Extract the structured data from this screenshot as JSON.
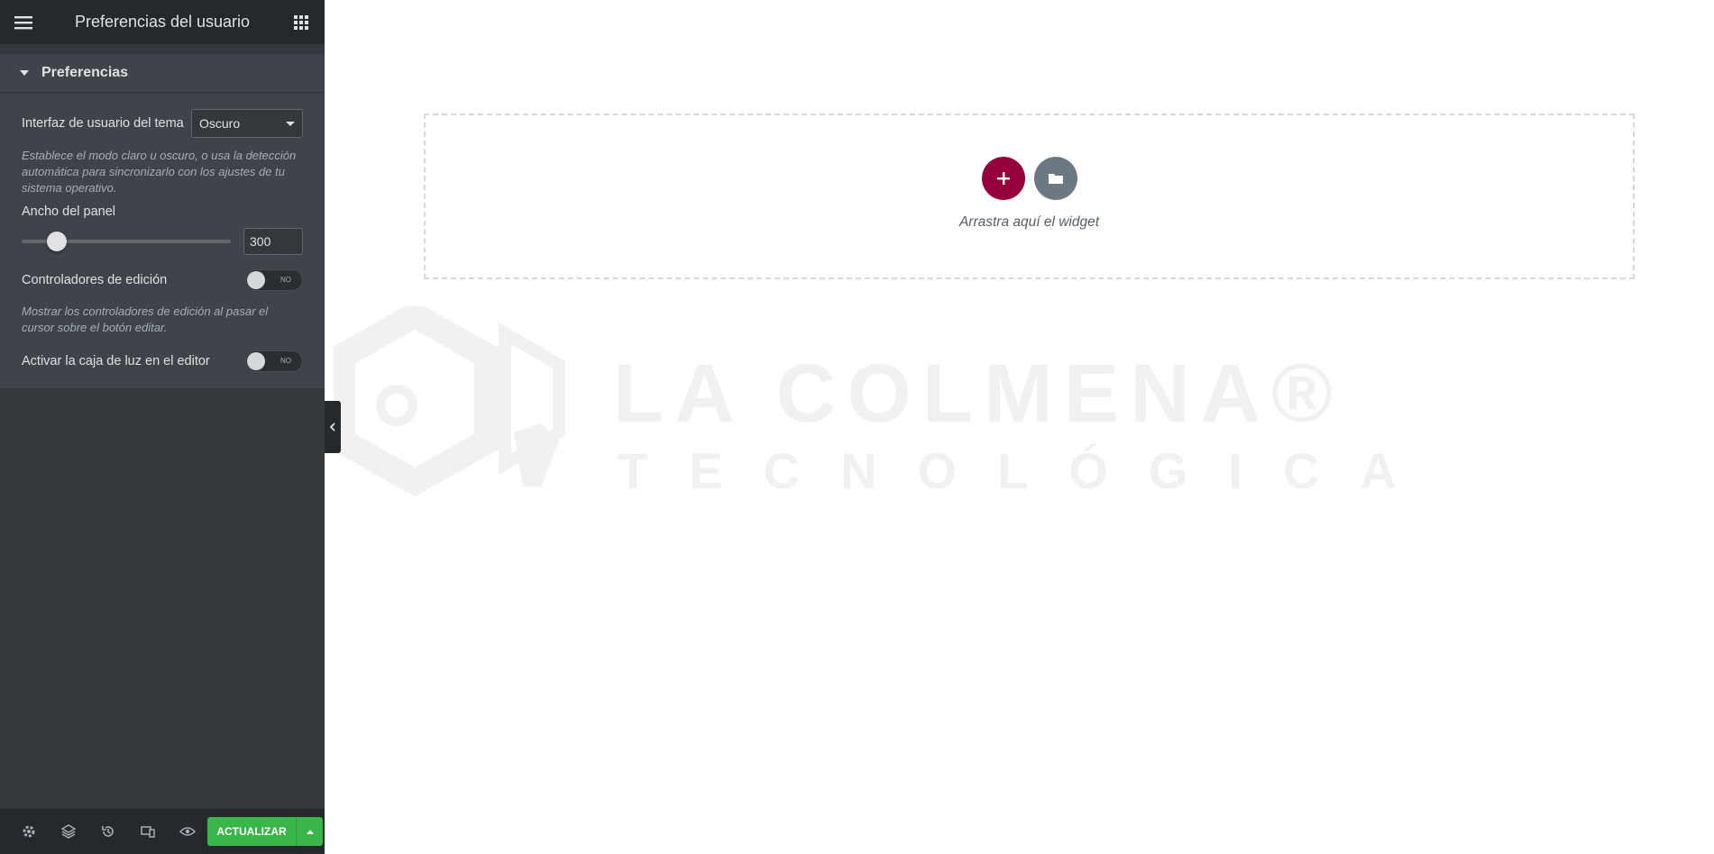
{
  "panel": {
    "title": "Preferencias del usuario",
    "section_title": "Preferencias",
    "theme": {
      "label": "Interfaz de usuario del tema",
      "value": "Oscuro",
      "description": "Establece el modo claro u oscuro, o usa la detección automática para sincronizarlo con los ajustes de tu sistema operativo."
    },
    "panel_width": {
      "label": "Ancho del panel",
      "value": "300",
      "slider_fraction": 0.17
    },
    "edit_handles": {
      "label": "Controladores de edición",
      "toggle_text": "NO",
      "description": "Mostrar los controladores de edición al pasar el cursor sobre el botón editar."
    },
    "lightbox": {
      "label": "Activar la caja de luz en el editor",
      "toggle_text": "NO"
    }
  },
  "footer": {
    "icons": [
      "settings-icon",
      "layers-icon",
      "history-icon",
      "responsive-icon",
      "preview-icon"
    ],
    "update_label": "ACTUALIZAR"
  },
  "canvas": {
    "drop_text": "Arrastra aquí el widget",
    "watermark_line1": "LA COLMENA®",
    "watermark_line2": "TECNOLÓGICA"
  },
  "colors": {
    "panel_bg": "#34383c",
    "header_bg": "#26292c",
    "update_green": "#39b54a",
    "add_section": "#93003c",
    "add_template": "#6d7882"
  }
}
